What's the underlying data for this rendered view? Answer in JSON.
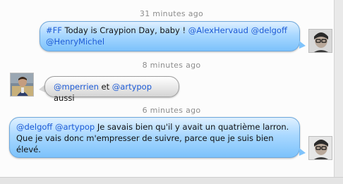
{
  "messages": [
    {
      "timestamp": "31 minutes ago",
      "line1": {
        "tag": "#FF",
        "text1": " Today is Craypion Day, baby ! ",
        "m1": "@AlexHervaud",
        "sp": " ",
        "m2": "@delgoff"
      },
      "line2": {
        "m3": "@HenryMichel"
      }
    },
    {
      "timestamp": "8 minutes ago",
      "line1": {
        "m1": "@mperrien",
        "t1": " et ",
        "m2": "@artypop",
        "t2": " aussi"
      }
    },
    {
      "timestamp": "6 minutes ago",
      "line1": {
        "m1": "@delgoff",
        "sp": " ",
        "m2": "@artypop",
        "t1": " Je savais bien qu'il y avait un quatrième larron."
      },
      "line2": "Que je vais donc m'empresser de suivre, parce que je suis bien",
      "line3": "élevé."
    }
  ],
  "colors": {
    "link": "#1c5ad6",
    "bubble_blue": "#a9d8ff",
    "bubble_grey": "#ececec",
    "timestamp": "#8d8d8d"
  }
}
